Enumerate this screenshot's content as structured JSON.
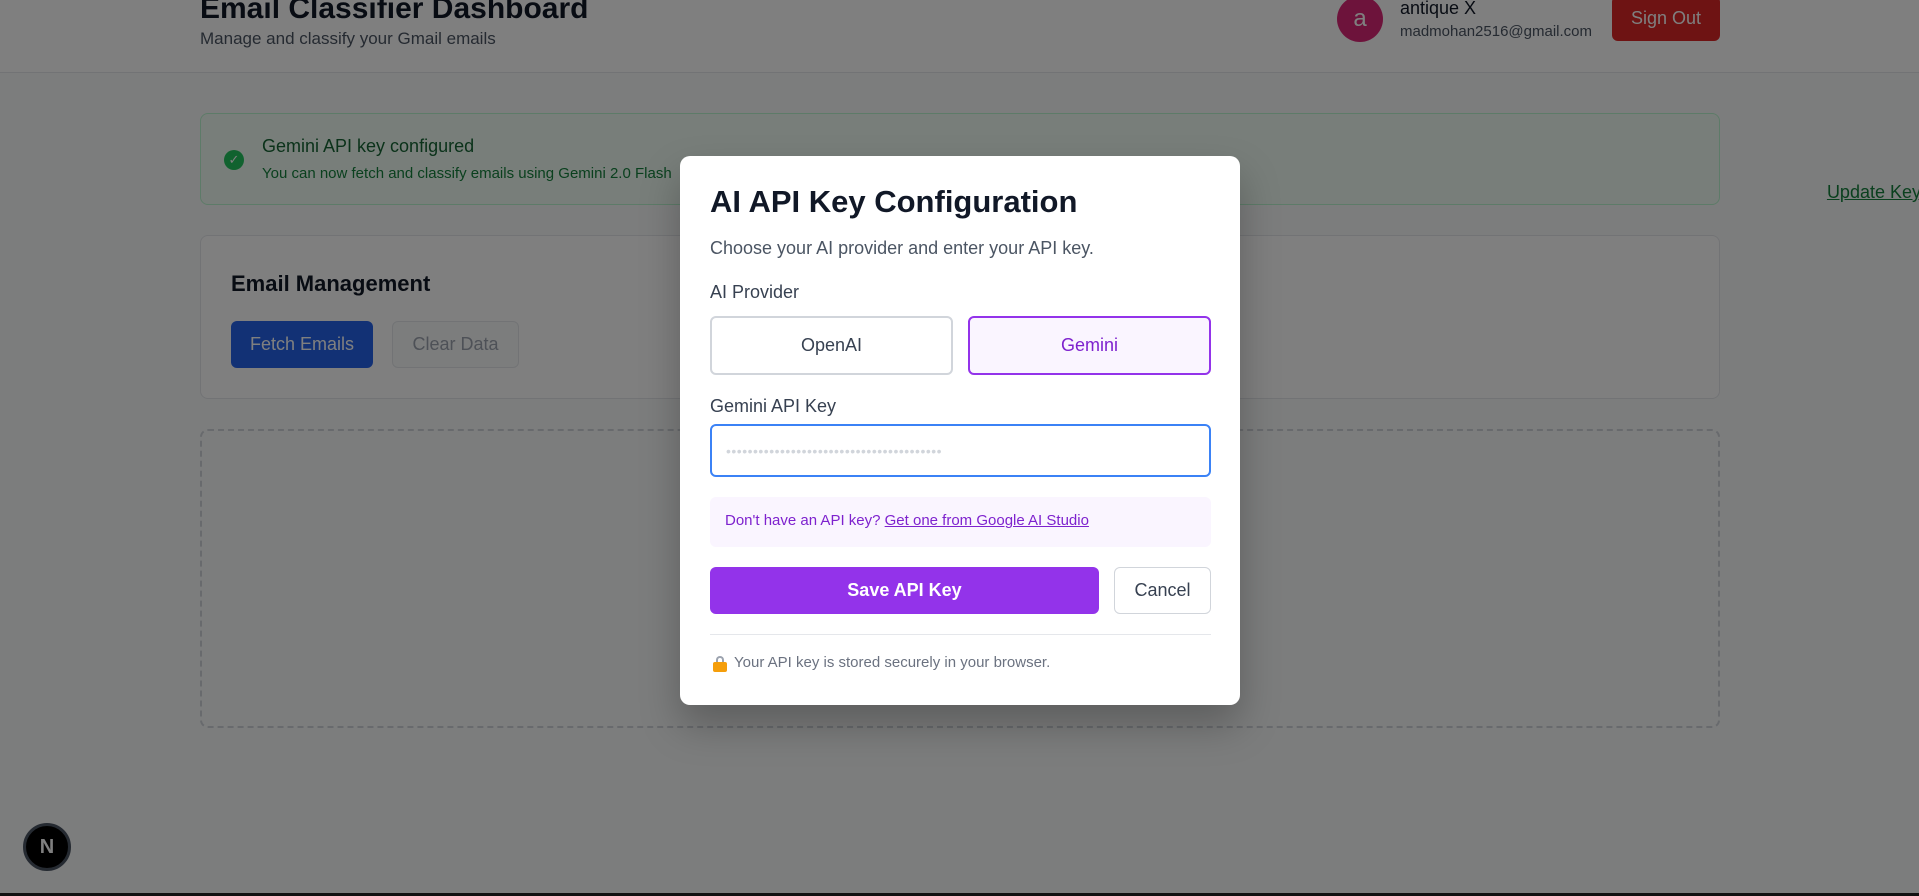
{
  "header": {
    "title": "Email Classifier Dashboard",
    "subtitle": "Manage and classify your Gmail emails",
    "avatar_letter": "a",
    "user_name": "antique X",
    "user_email": "madmohan2516@gmail.com",
    "sign_out_label": "Sign Out"
  },
  "banner": {
    "title": "Gemini API key configured",
    "text": "You can now fetch and classify emails using Gemini 2.0 Flash",
    "update_key_label": "Update Key"
  },
  "email_management": {
    "title": "Email Management",
    "fetch_label": "Fetch Emails",
    "clear_label": "Clear Data"
  },
  "modal": {
    "title": "AI API Key Configuration",
    "subtitle": "Choose your AI provider and enter your API key.",
    "provider_label": "AI Provider",
    "providers": [
      {
        "label": "OpenAI",
        "selected": false
      },
      {
        "label": "Gemini",
        "selected": true
      }
    ],
    "key_label": "Gemini API Key",
    "key_placeholder": "••••••••••••••••••••••••••••••••••••••••",
    "info_prefix": "Don't have an API key? ",
    "info_link": "Get one from Google AI Studio",
    "save_label": "Save API Key",
    "cancel_label": "Cancel",
    "security_note": "Your API key is stored securely in your browser."
  },
  "dev_badge": {
    "label": "N"
  },
  "colors": {
    "accent_purple": "#9333ea",
    "primary_blue": "#2563eb",
    "danger_red": "#dc2626",
    "success_green": "#22c55e",
    "avatar_pink": "#db2777"
  }
}
